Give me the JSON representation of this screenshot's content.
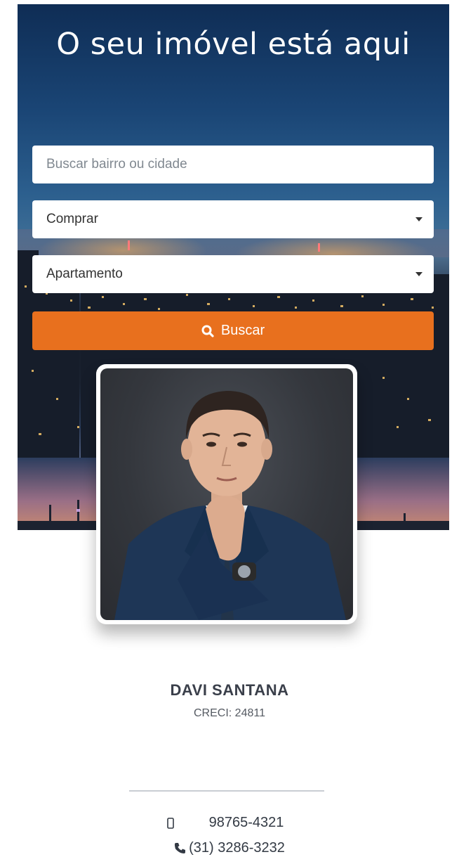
{
  "hero": {
    "title": "O seu imóvel está aqui"
  },
  "search": {
    "placeholder": "Buscar bairro ou cidade",
    "transaction_value": "Comprar",
    "property_type_value": "Apartamento",
    "button_label": "Buscar",
    "button_icon": "search-icon",
    "accent_color": "#e8701e"
  },
  "agent": {
    "name": "DAVI SANTANA",
    "creci": "CRECI: 24811",
    "photo_icon": "agent-photo"
  },
  "contacts": {
    "mobile": "98765-4321",
    "mobile_icon": "mobile-phone-icon",
    "phone": "(31) 3286-3232",
    "phone_icon": "phone-icon"
  }
}
